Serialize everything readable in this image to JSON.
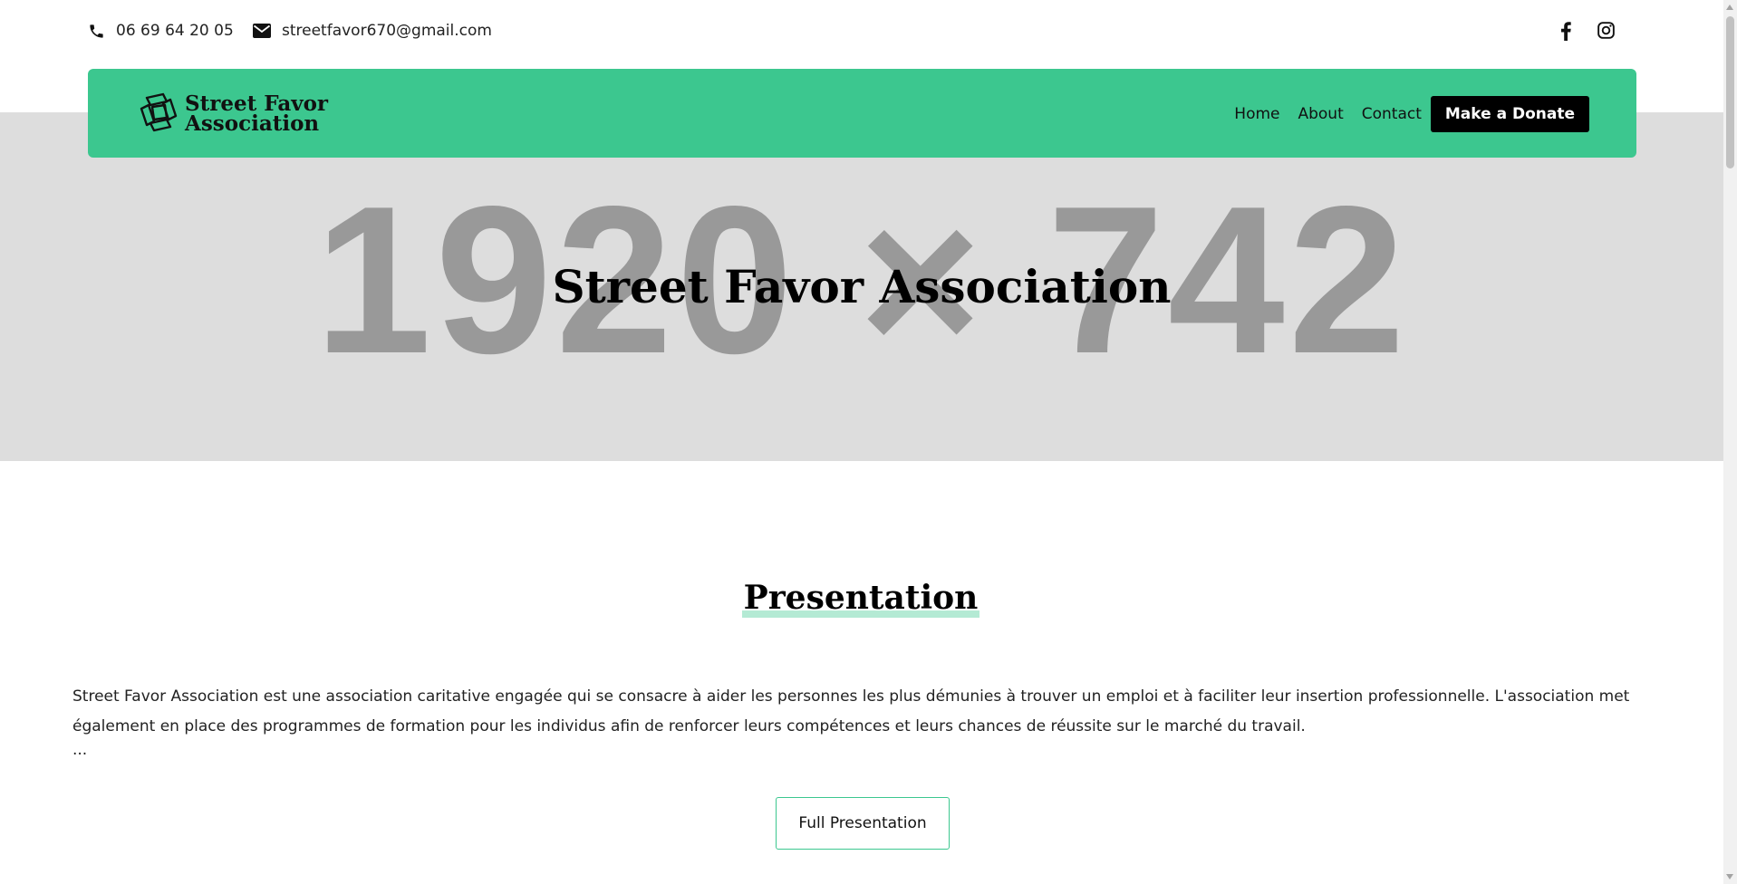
{
  "topbar": {
    "phone": "06 69 64 20 05",
    "email": "streetfavor670@gmail.com",
    "icons": {
      "phone": "phone-icon",
      "email": "envelope-icon",
      "facebook": "facebook-icon",
      "instagram": "instagram-icon"
    }
  },
  "navbar": {
    "logo_line1": "Street Favor",
    "logo_line2": "Association",
    "links": [
      "Home",
      "About",
      "Contact"
    ],
    "donate_label": "Make a Donate",
    "background_color": "#3cc78f"
  },
  "hero": {
    "placeholder_text": "1920 × 742",
    "title": "Street Favor Association",
    "background_color": "#dddddd"
  },
  "presentation": {
    "heading": "Presentation",
    "body": "Street Favor Association est une association caritative engagée qui se consacre à aider les personnes les plus démunies à trouver un emploi et à faciliter leur insertion professionnelle. L'association met également en place des programmes de formation pour les individus afin de renforcer leurs compétences et leurs chances de réussite sur le marché du travail.",
    "ellipsis": "...",
    "button_label": "Full Presentation",
    "accent_color": "#b4ead4"
  }
}
